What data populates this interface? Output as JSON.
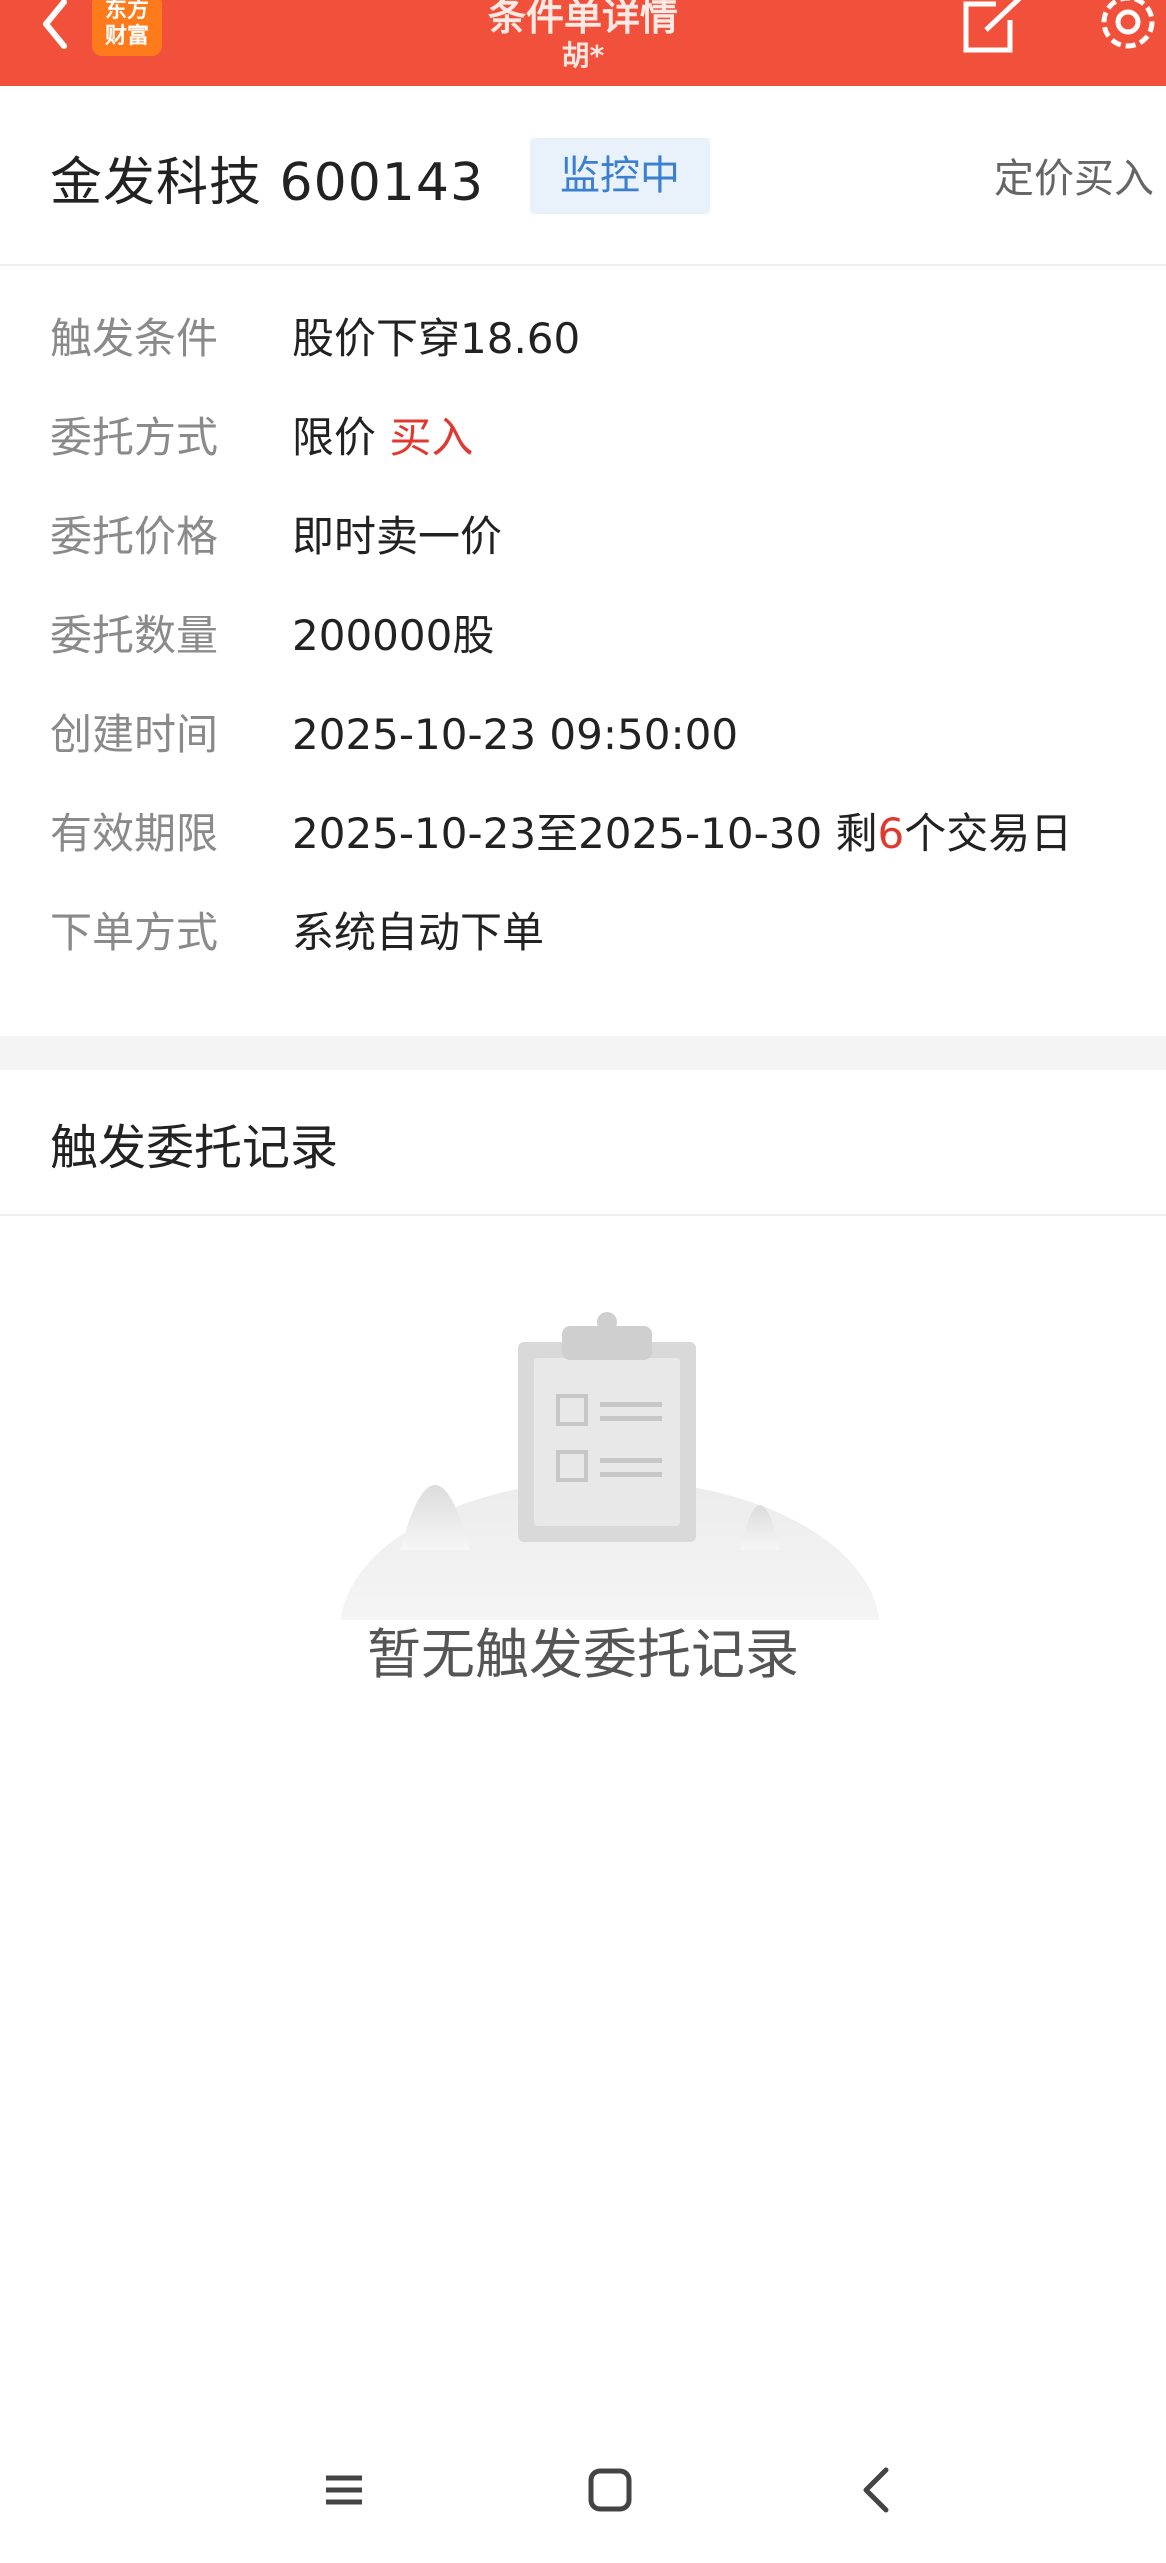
{
  "header": {
    "logo_line1": "东方",
    "logo_line2": "财富",
    "title": "条件单详情",
    "subtitle": "胡*",
    "icons": {
      "back": "chevron-left-icon",
      "share": "share-icon",
      "settings": "gear-icon"
    },
    "colors": {
      "background": "#f1513b",
      "logo": "#ff7a1a"
    }
  },
  "stock": {
    "name_code": "金发科技 600143",
    "status": "监控中",
    "order_type": "定价买入"
  },
  "details": [
    {
      "label": "触发条件",
      "value": "股价下穿18.60"
    },
    {
      "label": "委托方式",
      "value": "限价",
      "value_highlight": "买入"
    },
    {
      "label": "委托价格",
      "value": "即时卖一价"
    },
    {
      "label": "委托数量",
      "value": "200000股"
    },
    {
      "label": "创建时间",
      "value": "2025-10-23 09:50:00"
    },
    {
      "label": "有效期限",
      "value": "2025-10-23至2025-10-30 剩",
      "value_highlight": "6",
      "value_suffix": "个交易日"
    },
    {
      "label": "下单方式",
      "value": "系统自动下单"
    }
  ],
  "records": {
    "title": "触发委托记录",
    "empty_text": "暂无触发委托记录",
    "empty_icon": "clipboard-icon"
  },
  "navbar": {
    "icons": [
      "menu-icon",
      "home-icon",
      "back-icon"
    ]
  },
  "colors": {
    "accent_red": "#e03a30",
    "badge_blue": "#3a7fd0",
    "badge_bg": "#e9f1fb"
  }
}
